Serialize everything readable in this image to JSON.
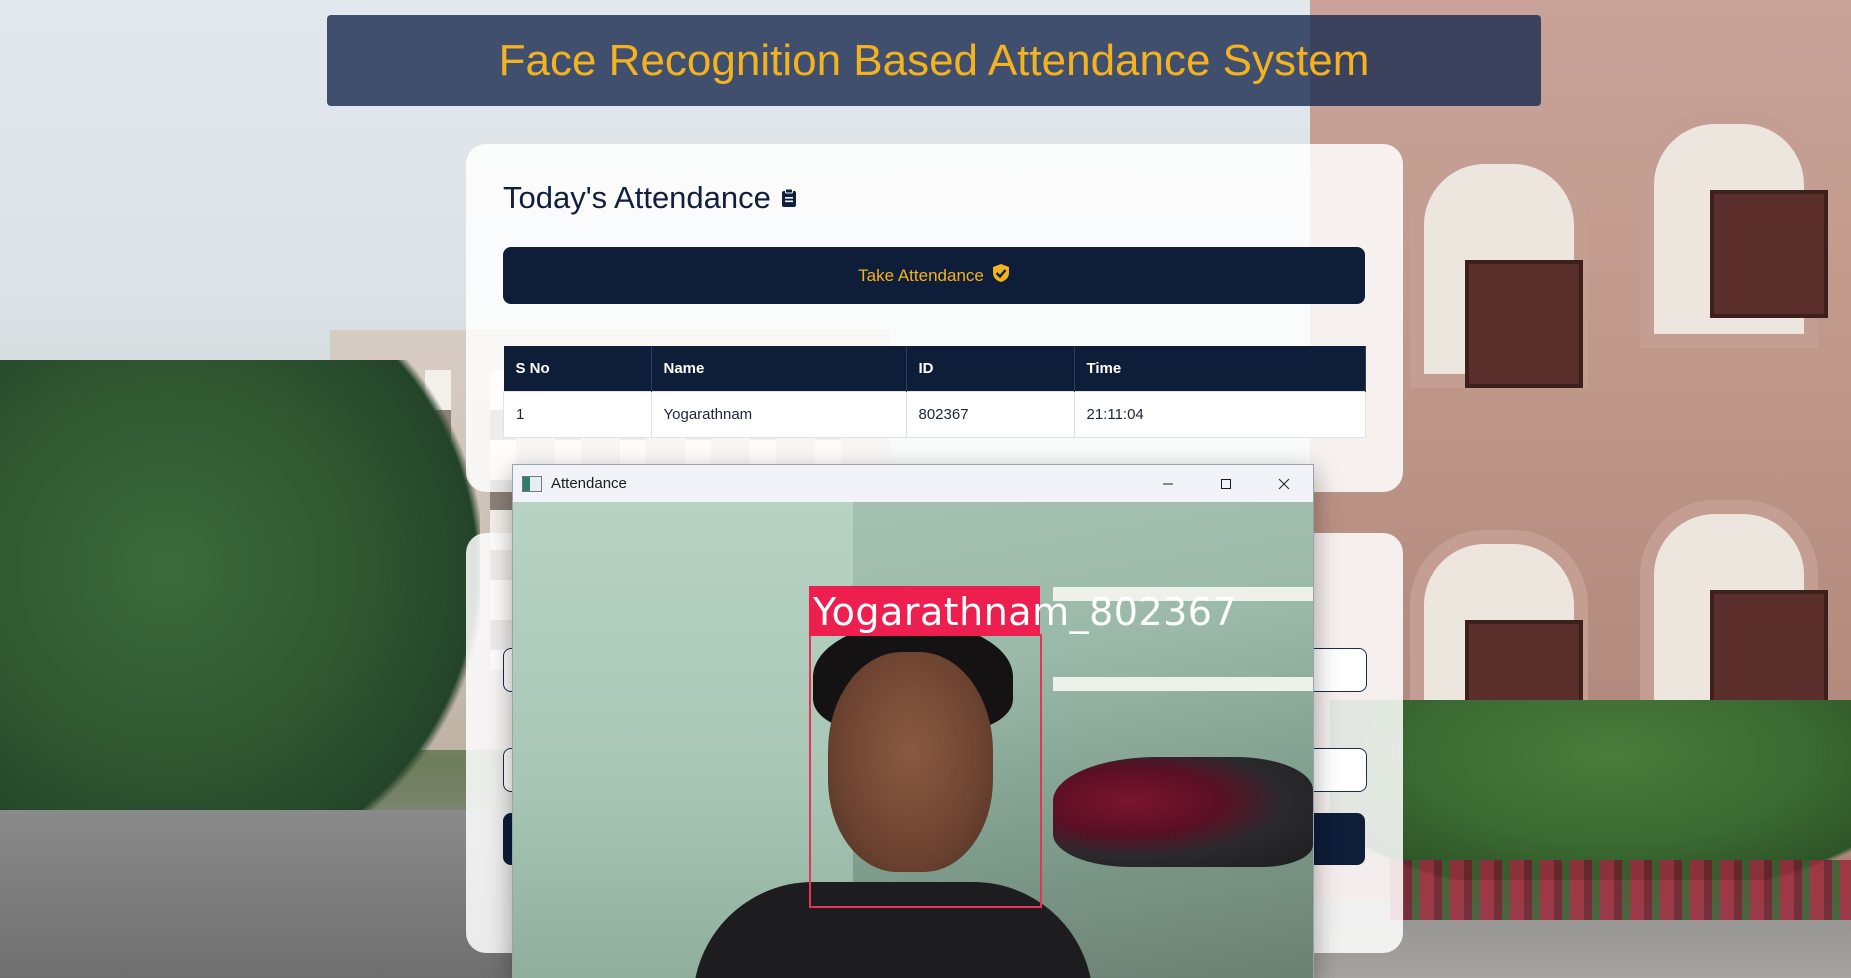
{
  "app": {
    "title": "Face Recognition Based Attendance System"
  },
  "attendance_card": {
    "title": "Today's Attendance",
    "title_icon": "clipboard-icon",
    "take_button": {
      "label": "Take Attendance",
      "icon": "shield-check-icon"
    },
    "table": {
      "headers": [
        "S No",
        "Name",
        "ID",
        "Time"
      ],
      "rows": [
        [
          "1",
          "Yogarathnam",
          "802367",
          "21:11:04"
        ]
      ]
    }
  },
  "camera_window": {
    "title": "Attendance",
    "controls": [
      "minimize-icon",
      "maximize-icon",
      "close-icon"
    ],
    "detection_label": "Yogarathnam_802367"
  },
  "colors": {
    "accent": "#f3b21f",
    "navy": "#0e1d38",
    "detection": "#ec1f4e"
  }
}
